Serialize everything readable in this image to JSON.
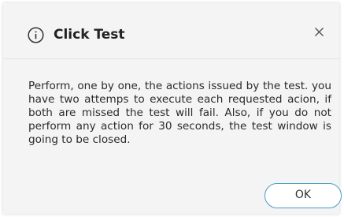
{
  "dialog": {
    "title": "Click Test",
    "info_icon": "info-icon",
    "close_icon": "close-icon",
    "message": "Perform, one by one, the actions issued by the test. you have two attemps to execute each requested acion, if both are missed the test will fail. Also, if you do not perform any action for 30 seconds, the test window is going to be closed.",
    "ok_label": "OK"
  },
  "colors": {
    "background": "#f4f4f4",
    "accent": "#4a9cc7",
    "text": "#222222"
  }
}
